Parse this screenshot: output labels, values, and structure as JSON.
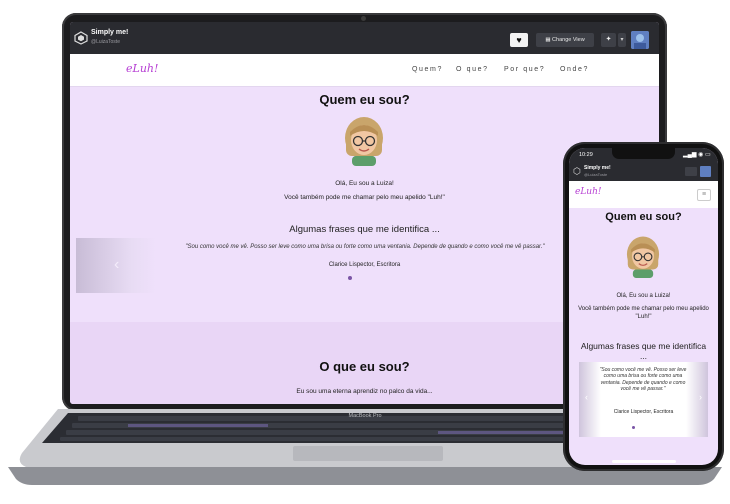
{
  "laptop": {
    "app_bar": {
      "title": "Simply me!",
      "subtitle": "@LuizaToste",
      "change_view_label": "Change View"
    },
    "site": {
      "brand": "eLuh!",
      "nav": [
        "Quem?",
        "O que?",
        "Por que?",
        "Onde?"
      ],
      "section1": {
        "title": "Quem eu sou?",
        "greeting": "Olá, Eu sou a Luiza!",
        "nickname": "Você também pode me chamar pelo meu apelido \"Luh!\"",
        "phrases_title": "Algumas frases que me identifica ...",
        "quote": "\"Sou como você me vê. Posso ser leve como uma brisa ou forte como uma ventania. Depende de quando e como você me vê passar.\"",
        "author": "Clarice Lispector, Escritora"
      },
      "section2": {
        "title": "O que eu sou?",
        "text": "Eu sou uma eterna aprendiz no palco da vida..."
      }
    },
    "model_label": "MacBook Pro"
  },
  "phone": {
    "time": "10:29",
    "app_title": "Simply me!",
    "app_subtitle": "@LuizaToste",
    "brand": "eLuh!",
    "title": "Quem eu sou?",
    "greeting": "Olá, Eu sou a Luiza!",
    "nickname": "Você também pode me chamar pelo meu apelido \"Luh!\"",
    "phrases_title": "Algumas frases que me identifica ...",
    "quote": "\"Sou como você me vê. Posso ser leve como uma brisa ou forte como uma ventania. Depende de quando e como você me vê passar.\"",
    "author": "Clarice Lispector, Escritora"
  },
  "icons": {
    "heart": "heart-icon",
    "calendar": "calendar-icon",
    "pin": "pin-icon",
    "menu": "hamburger-menu-icon",
    "prev": "chevron-left-icon",
    "next": "chevron-right-icon"
  },
  "colors": {
    "page_background": "#efe0fb",
    "brand": "#b63ed3",
    "app_bar": "#2a2b30",
    "section_alt": "#e9d6f6"
  }
}
